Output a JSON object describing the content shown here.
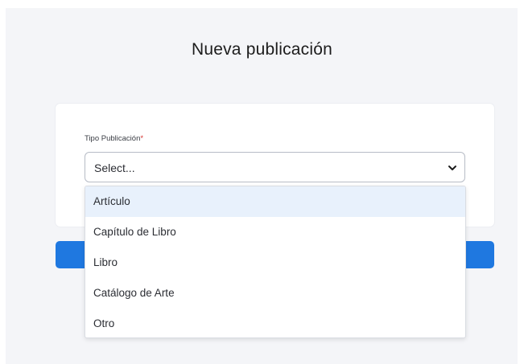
{
  "page": {
    "title": "Nueva publicación"
  },
  "form": {
    "tipo_publicacion": {
      "label": "Tipo Publicación",
      "required_marker": "*",
      "selected_value": "Select...",
      "options": [
        "Artículo",
        "Capítulo de Libro",
        "Libro",
        "Catálogo de Arte",
        "Otro"
      ],
      "highlighted_option": "Artículo"
    }
  },
  "icons": {
    "dropdown_toggle": "chevron-down-icon"
  },
  "colors": {
    "accent": "#1f78e0",
    "required": "#d6332f",
    "highlight": "#e8f1fc",
    "page_background": "#f4f5f8"
  }
}
